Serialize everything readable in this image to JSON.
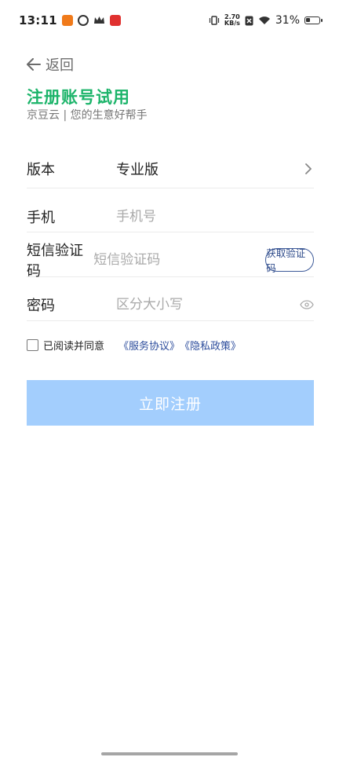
{
  "status_bar": {
    "time": "13:11",
    "net_speed_value": "2.70",
    "net_speed_unit": "KB/s",
    "battery": "31%",
    "battery_level": 0.31,
    "icons": [
      "vibrate-icon",
      "sim-off-icon",
      "wifi-icon",
      "battery-icon"
    ]
  },
  "nav": {
    "back_label": "返回"
  },
  "header": {
    "title": "注册账号试用",
    "subtitle": "京豆云 | 您的生意好帮手"
  },
  "form": {
    "version": {
      "label": "版本",
      "value": "专业版"
    },
    "phone": {
      "label": "手机",
      "placeholder": "手机号"
    },
    "sms_code": {
      "label": "短信验证码",
      "placeholder": "短信验证码",
      "button": "获取验证码"
    },
    "password": {
      "label": "密码",
      "placeholder": "区分大小写"
    }
  },
  "agreement": {
    "text": "已阅读并同意",
    "service_link": "《服务协议》",
    "privacy_link": "《隐私政策》"
  },
  "submit": {
    "label": "立即注册"
  },
  "colors": {
    "title_green": "#1cb46a",
    "link_blue": "#2c4c9c",
    "submit_bg": "#a3cefd"
  }
}
